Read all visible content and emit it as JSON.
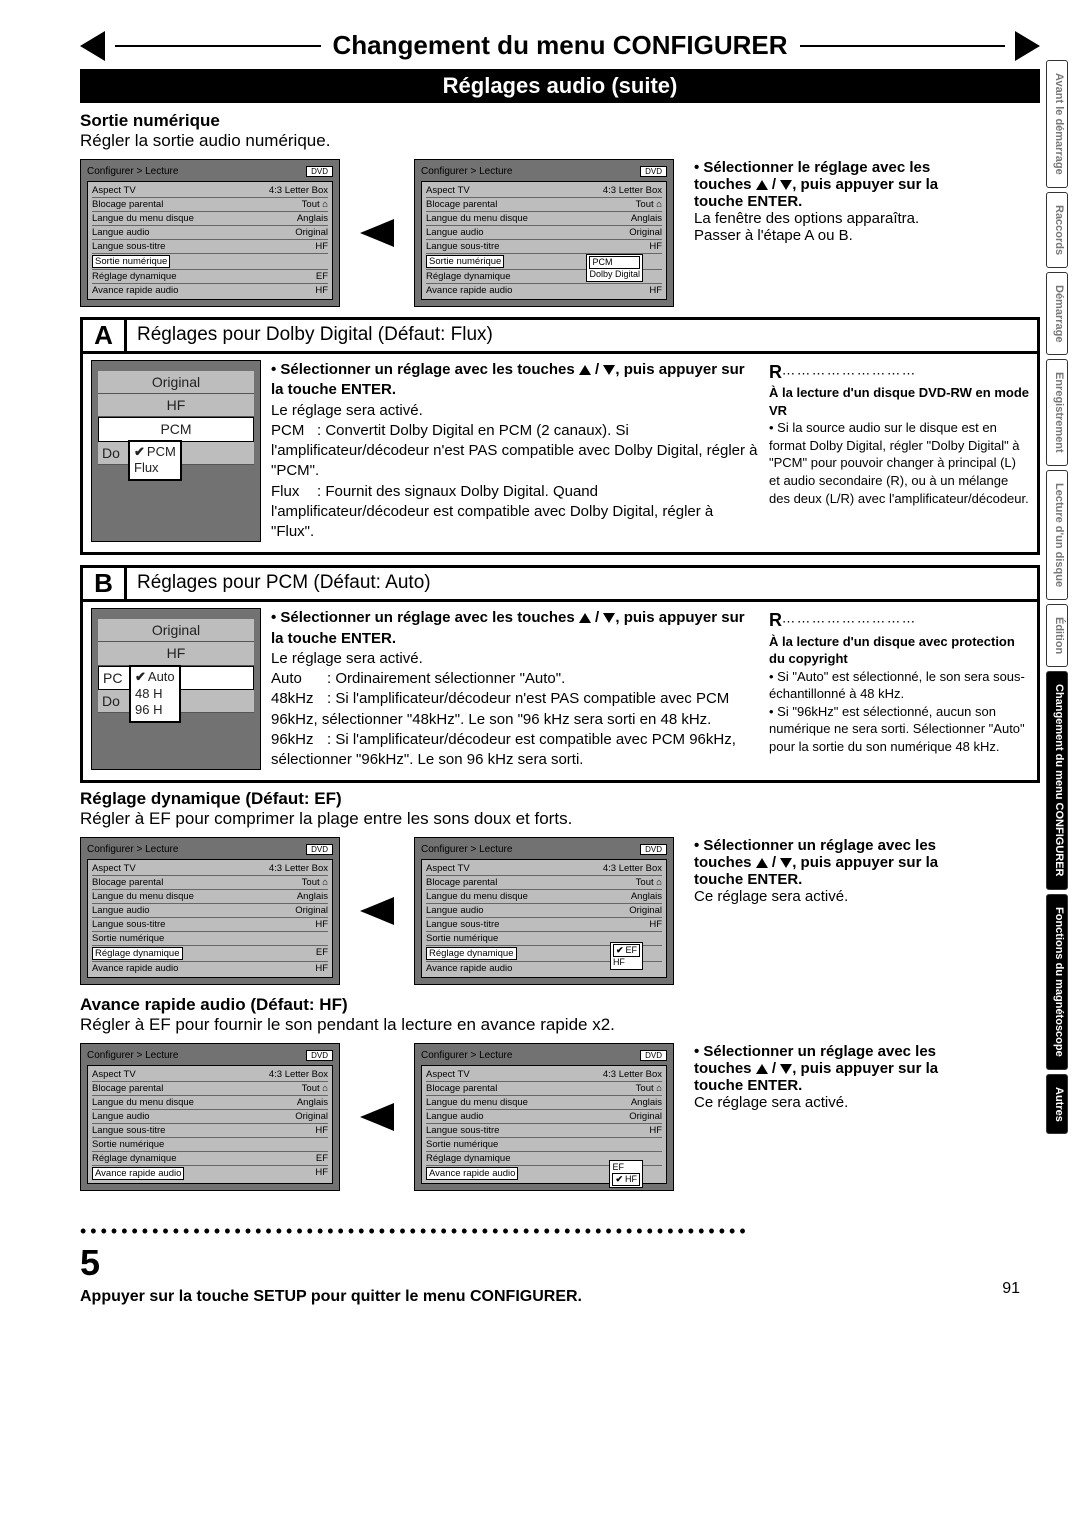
{
  "header": {
    "title": "Changement du menu CONFIGURER",
    "subtitle": "Réglages audio (suite)"
  },
  "section1": {
    "label": "Sortie numérique",
    "desc": "Régler la sortie audio numérique."
  },
  "panel_common": {
    "breadcrumb": "Configurer > Lecture",
    "badge": "DVD",
    "rows": {
      "aspect": {
        "k": "Aspect TV",
        "v": "4:3 Letter Box"
      },
      "parental": {
        "k": "Blocage parental",
        "v": "Tout ⌂"
      },
      "menu_lang": {
        "k": "Langue du menu disque",
        "v": "Anglais"
      },
      "audio_lang": {
        "k": "Langue audio",
        "v": "Original"
      },
      "sub_lang": {
        "k": "Langue sous-titre",
        "v": "HF"
      },
      "digital_out": {
        "k": "Sortie numérique",
        "v": ""
      },
      "dyn": {
        "k": "Réglage dynamique",
        "v": "EF"
      },
      "ffwd": {
        "k": "Avance rapide audio",
        "v": "HF"
      }
    }
  },
  "popup_digital": {
    "opt1": "PCM",
    "opt2": "Dolby Digital"
  },
  "right1": {
    "bullet": "Sélectionner le réglage avec les touches ",
    "bullet2": ", puis appuyer sur la touche ENTER.",
    "line1": "La fenêtre des options apparaîtra.",
    "line2": "Passer à l'étape A ou B."
  },
  "blockA": {
    "letter": "A",
    "title": "Réglages pour Dolby Digital (Défaut: Flux)",
    "mini": {
      "r1": "Original",
      "r2": "HF",
      "r3": "PCM",
      "r4": "Do",
      "popA": "PCM",
      "popB": "Flux"
    },
    "mid": {
      "b1": "Sélectionner un réglage avec les touches",
      "b2": ", puis appuyer sur la touche ENTER.",
      "l1": "Le réglage sera activé.",
      "pcm_lbl": "PCM",
      "pcm": ": Convertit Dolby Digital en PCM (2 canaux). Si l'amplificateur/décodeur n'est PAS compatible avec Dolby Digital, régler à \"PCM\".",
      "flux_lbl": "Flux",
      "flux": ": Fournit des signaux Dolby Digital. Quand l'amplificateur/décodeur est compatible avec Dolby Digital, régler à \"Flux\"."
    },
    "note": {
      "r": "R",
      "head": "À la lecture d'un disque DVD-RW en mode VR",
      "body": "Si la source audio sur le disque est en format Dolby Digital, régler \"Dolby Digital\" à \"PCM\" pour pouvoir changer à principal (L) et audio secondaire (R), ou à un mélange des deux (L/R) avec l'amplificateur/décodeur."
    }
  },
  "blockB": {
    "letter": "B",
    "title": "Réglages pour PCM (Défaut: Auto)",
    "mini": {
      "r1": "Original",
      "r2": "HF",
      "r3": "PC",
      "r4": "Do",
      "popA": "Auto",
      "popB": "48 H",
      "popC": "96 H"
    },
    "mid": {
      "b1": "Sélectionner un réglage avec les touches",
      "b2": ", puis appuyer sur la touche ENTER.",
      "l1": "Le réglage sera activé.",
      "auto_lbl": "Auto",
      "auto": ": Ordinairement sélectionner \"Auto\".",
      "k48_lbl": "48kHz",
      "k48": ": Si l'amplificateur/décodeur n'est PAS compatible avec PCM 96kHz, sélectionner \"48kHz\". Le son \"96 kHz sera sorti en 48 kHz.",
      "k96_lbl": "96kHz",
      "k96": ": Si l'amplificateur/décodeur est compatible avec PCM 96kHz, sélectionner \"96kHz\". Le son 96 kHz sera sorti."
    },
    "note": {
      "r": "R",
      "head": "À la lecture d'un disque avec protection du copyright",
      "b1": "Si \"Auto\" est sélectionné, le son sera sous-échantillonné à 48 kHz.",
      "b2": "Si \"96kHz\" est sélectionné, aucun son numérique ne sera sorti. Sélectionner \"Auto\" pour la sortie du son numérique 48 kHz."
    }
  },
  "section3": {
    "label": "Réglage dynamique (Défaut: EF)",
    "desc": "Régler à EF pour comprimer la plage entre les sons doux et forts.",
    "popup": {
      "a": "EF",
      "b": "HF"
    },
    "right_b1": "Sélectionner un réglage avec les touches ",
    "right_b2": ", puis appuyer sur la touche ENTER.",
    "right_l1": "Ce réglage sera activé."
  },
  "section4": {
    "label": "Avance rapide audio (Défaut: HF)",
    "desc": "Régler à EF pour fournir le son pendant la lecture en avance rapide x2.",
    "popup": {
      "a": "EF",
      "b": "HF"
    },
    "right_b1": "Sélectionner un réglage avec les touches ",
    "right_b2": ", puis appuyer sur la touche ENTER.",
    "right_l1": "Ce réglage sera activé."
  },
  "step": {
    "num": "5",
    "text": "Appuyer sur la touche SETUP pour quitter le menu CONFIGURER."
  },
  "page_num": "91",
  "tabs": [
    "Avant le démarrage",
    "Raccords",
    "Démarrage",
    "Enregistrement",
    "Lecture d'un disque",
    "Édition",
    "Changement du menu CONFIGURER",
    "Fonctions du magnétoscope",
    "Autres"
  ]
}
